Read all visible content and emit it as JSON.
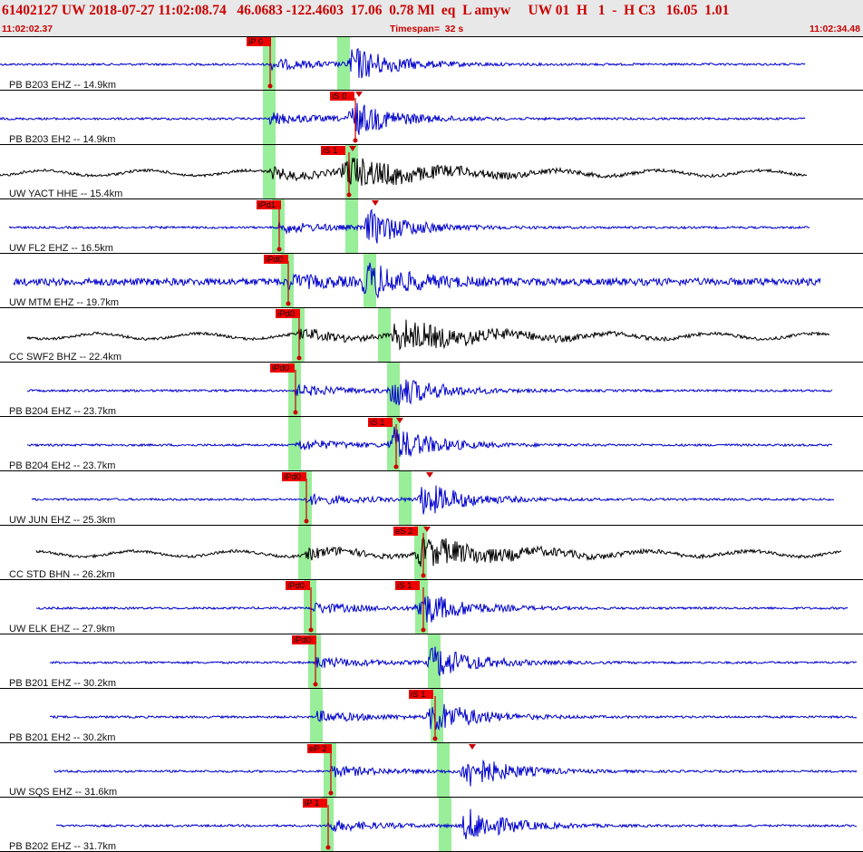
{
  "header": {
    "title": "61402127 UW 2018-07-27 11:02:08.74   46.0683 -122.4603  17.06  0.78 Ml  eq  L amyw     UW 01  H   1  -  H C3   16.05  1.01",
    "start_time": "11:02:02.37",
    "timespan": "Timespan=  32 s",
    "end_time": "11:02:34.48"
  },
  "colors": {
    "header_bg": "#e8e8e8",
    "header_text": "#cc0000",
    "trace_blue": "#0000cc",
    "trace_black": "#000000",
    "pick_bg": "#ee0000",
    "window_green": "#99ee99",
    "separator": "#000000"
  },
  "traces": [
    {
      "label": "PB B203 EHZ -- 14.9km",
      "color": "blue",
      "picks": [
        {
          "text": "iP 0",
          "kind": "P"
        }
      ],
      "windows": 2,
      "s_marker": false
    },
    {
      "label": "PB B203 EH2 -- 14.9km",
      "color": "blue",
      "picks": [
        {
          "text": "iS 0",
          "kind": "S"
        }
      ],
      "windows": 1,
      "s_marker": true
    },
    {
      "label": "UW YACT HHE -- 15.4km",
      "color": "black",
      "picks": [
        {
          "text": "iS 1",
          "kind": "S"
        }
      ],
      "windows": 2,
      "s_marker": true
    },
    {
      "label": "UW FL2 EHZ -- 16.5km",
      "color": "blue",
      "picks": [
        {
          "text": "iPd1",
          "kind": "P"
        }
      ],
      "windows": 2,
      "s_marker": true
    },
    {
      "label": "UW MTM EHZ -- 19.7km",
      "color": "blue",
      "picks": [
        {
          "text": "iPd0",
          "kind": "P"
        }
      ],
      "windows": 2,
      "s_marker": false
    },
    {
      "label": "CC SWF2 BHZ -- 22.4km",
      "color": "black",
      "picks": [
        {
          "text": "iPd0",
          "kind": "P"
        }
      ],
      "windows": 2,
      "s_marker": false
    },
    {
      "label": "PB B204 EHZ -- 23.7km",
      "color": "blue",
      "picks": [
        {
          "text": "iPd0",
          "kind": "P"
        }
      ],
      "windows": 2,
      "s_marker": false
    },
    {
      "label": "PB B204 EH2 -- 23.7km",
      "color": "blue",
      "picks": [
        {
          "text": "iS 1",
          "kind": "S"
        }
      ],
      "windows": 2,
      "s_marker": true
    },
    {
      "label": "UW JUN EHZ -- 25.3km",
      "color": "blue",
      "picks": [
        {
          "text": "iPd0",
          "kind": "P"
        }
      ],
      "windows": 2,
      "s_marker": true
    },
    {
      "label": "CC STD BHN -- 26.2km",
      "color": "black",
      "picks": [
        {
          "text": "eS 2",
          "kind": "S"
        }
      ],
      "windows": 2,
      "s_marker": true
    },
    {
      "label": "UW ELK EHZ -- 27.9km",
      "color": "blue",
      "picks": [
        {
          "text": "iPd0",
          "kind": "P"
        },
        {
          "text": "iS 1",
          "kind": "S"
        }
      ],
      "windows": 2,
      "s_marker": false
    },
    {
      "label": "PB B201 EHZ -- 30.2km",
      "color": "blue",
      "picks": [
        {
          "text": "iPd0",
          "kind": "P"
        }
      ],
      "windows": 2,
      "s_marker": false
    },
    {
      "label": "PB B201 EH2 -- 30.2km",
      "color": "blue",
      "picks": [
        {
          "text": "iS 1",
          "kind": "S"
        }
      ],
      "windows": 2,
      "s_marker": false
    },
    {
      "label": "UW SQS EHZ -- 31.6km",
      "color": "blue",
      "picks": [
        {
          "text": "eP 2",
          "kind": "P"
        }
      ],
      "windows": 2,
      "s_marker": true
    },
    {
      "label": "PB B202 EHZ -- 31.7km",
      "color": "blue",
      "picks": [
        {
          "text": "iP 1",
          "kind": "P"
        }
      ],
      "windows": 2,
      "s_marker": false
    }
  ]
}
